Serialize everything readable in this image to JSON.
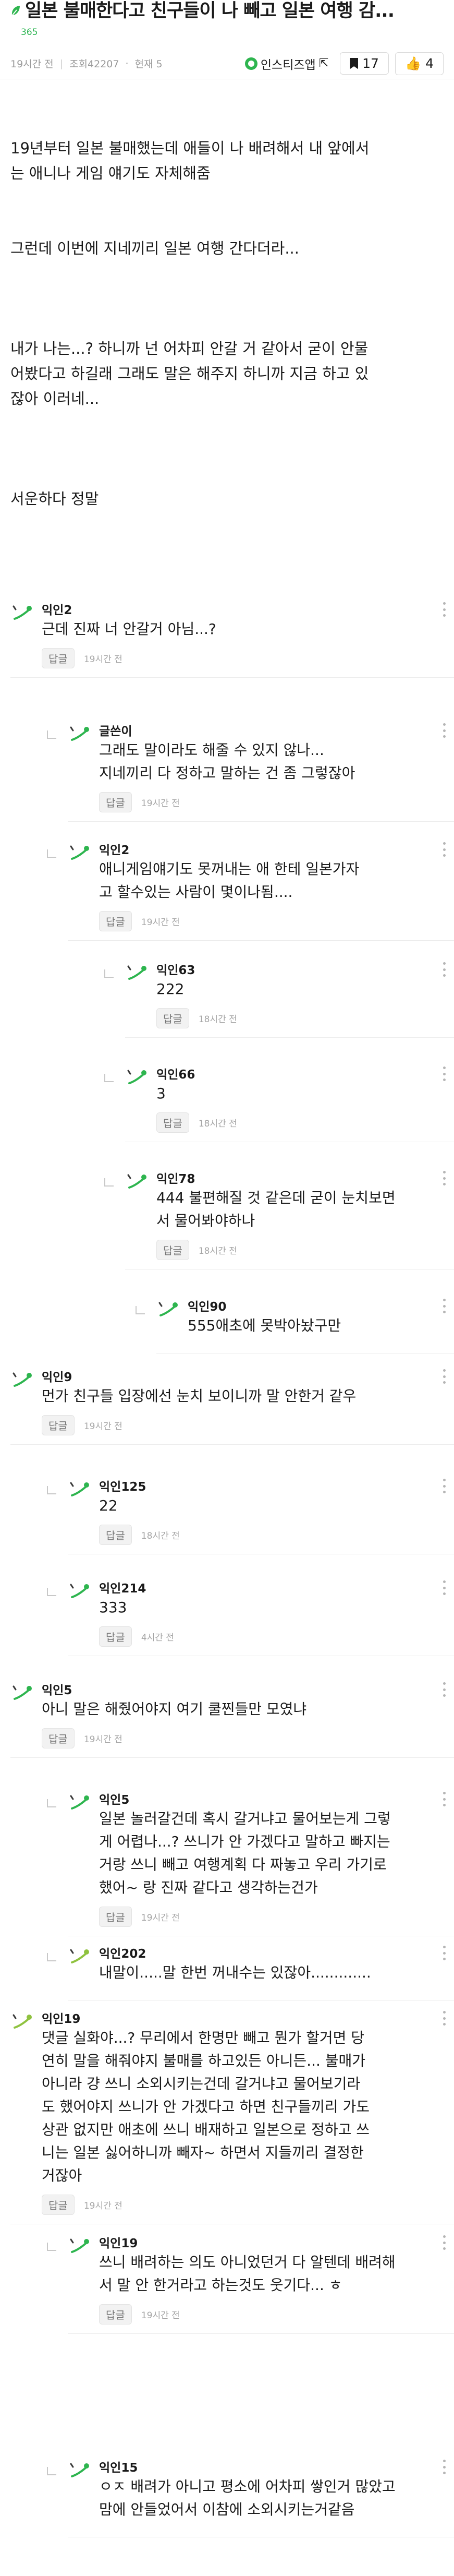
{
  "post": {
    "title": "일본 불매한다고 친구들이 나 빼고 일본 여행 감...",
    "tag": "365",
    "time": "19시간 전",
    "views": "조회42207",
    "order": "현재 5",
    "author": "인스티즈앱",
    "bookmark_count": "17",
    "like_count": "4",
    "body": [
      "19년부터 일본 불매했는데 애들이 나 배려해서 내 앞에서",
      "는 애니나 게임 얘기도 자체해줌",
      "",
      "",
      "그런데 이번에 지네끼리 일본 여행 간다더라...",
      "",
      "",
      "",
      "내가 나는...? 하니까 넌 어차피 안갈 거 같아서 굳이 안물",
      "어봤다고 하길래 그래도 말은 해주지 하니까 지금 하고 있",
      "잖아 이러네...",
      "",
      "",
      "",
      "서운하다 정말"
    ]
  },
  "reply_label": "답글",
  "comments": [
    {
      "nick": "익인2",
      "lines": [
        "근데 진짜 너 안갈거 아님...?"
      ],
      "time": "19시간 전",
      "avatar_color": "#2eb54f"
    },
    {
      "nick": "글쓴이",
      "lines": [
        "그래도 말이라도 해줄 수 있지 않나...",
        "지네끼리 다 정하고 말하는 건 좀 그렇잖아"
      ],
      "time": "19시간 전",
      "avatar_color": "#2eb54f"
    },
    {
      "nick": "익인2",
      "lines": [
        "애니게임얘기도 못꺼내는 애 한테 일본가자",
        "고 할수있는 사람이 몇이나됨...."
      ],
      "time": "19시간 전",
      "avatar_color": "#2eb54f"
    },
    {
      "nick": "익인63",
      "lines": [
        "222"
      ],
      "time": "18시간 전",
      "avatar_color": "#2eb54f"
    },
    {
      "nick": "익인66",
      "lines": [
        "3"
      ],
      "time": "18시간 전",
      "avatar_color": "#2eb54f"
    },
    {
      "nick": "익인78",
      "lines": [
        "444 불편해질 것 같은데 굳이 눈치보면",
        "서 물어봐야하나"
      ],
      "time": "18시간 전",
      "avatar_color": "#2eb54f"
    },
    {
      "nick": "익인90",
      "lines": [
        "555애초에 못박아놨구만"
      ],
      "time": "",
      "avatar_color": "#2eb54f"
    },
    {
      "nick": "익인9",
      "lines": [
        "먼가 친구들 입장에선 눈치 보이니까 말 안한거 같우"
      ],
      "time": "19시간 전",
      "avatar_color": "#2eb54f"
    },
    {
      "nick": "익인125",
      "lines": [
        "22"
      ],
      "time": "18시간 전",
      "avatar_color": "#2eb54f"
    },
    {
      "nick": "익인214",
      "lines": [
        "333"
      ],
      "time": "4시간 전",
      "avatar_color": "#2eb54f"
    },
    {
      "nick": "익인5",
      "lines": [
        "아니 말은 해줬어야지 여기 쿨찐들만 모였냐"
      ],
      "time": "19시간 전",
      "avatar_color": "#2eb54f"
    },
    {
      "nick": "익인5",
      "lines": [
        "일본 놀러갈건데 혹시 갈거냐고 물어보는게 그렇",
        "게 어렵나...? 쓰니가 안 가겠다고 말하고 빠지는",
        "거랑 쓰니 빼고 여행계획 다 짜놓고 우리 가기로",
        "했어~ 랑 진짜 같다고 생각하는건가"
      ],
      "time": "19시간 전",
      "avatar_color": "#2eb54f"
    },
    {
      "nick": "익인202",
      "lines": [
        "내말이.....말 한번 꺼내수는 있잖아............."
      ],
      "time": "",
      "avatar_color": "#8fc23f"
    },
    {
      "nick": "익인19",
      "lines": [
        "댓글 실화야...? 무리에서 한명만 빼고 뭔가 할거면 당",
        "연히 말을 해줘야지 불매를 하고있든 아니든... 불매가",
        "아니라 걍 쓰니 소외시키는건데 갈거냐고 물어보기라",
        "도 했어야지 쓰니가 안 가겠다고 하면 친구들끼리 가도",
        "상관 없지만 애초에 쓰니 배재하고 일본으로 정하고 쓰",
        "니는 일본 싫어하니까 빼자~ 하면서 지들끼리 결정한",
        "거잖아"
      ],
      "time": "19시간 전",
      "avatar_color": "#8fc23f"
    },
    {
      "nick": "익인19",
      "lines": [
        "쓰니 배려하는 의도 아니었던거 다 알텐데 배려해",
        "서 말 안 한거라고 하는것도 웃기다... ㅎ"
      ],
      "time": "19시간 전",
      "avatar_color": "#2eb54f"
    },
    {
      "nick": "익인15",
      "lines": [
        "ㅇㅈ 배려가 아니고 평소에 어차피 쌓인거 많았고",
        "맘에 안들었어서 이참에 소외시키는거같음"
      ],
      "time": "",
      "avatar_color": "#2eb54f"
    }
  ]
}
